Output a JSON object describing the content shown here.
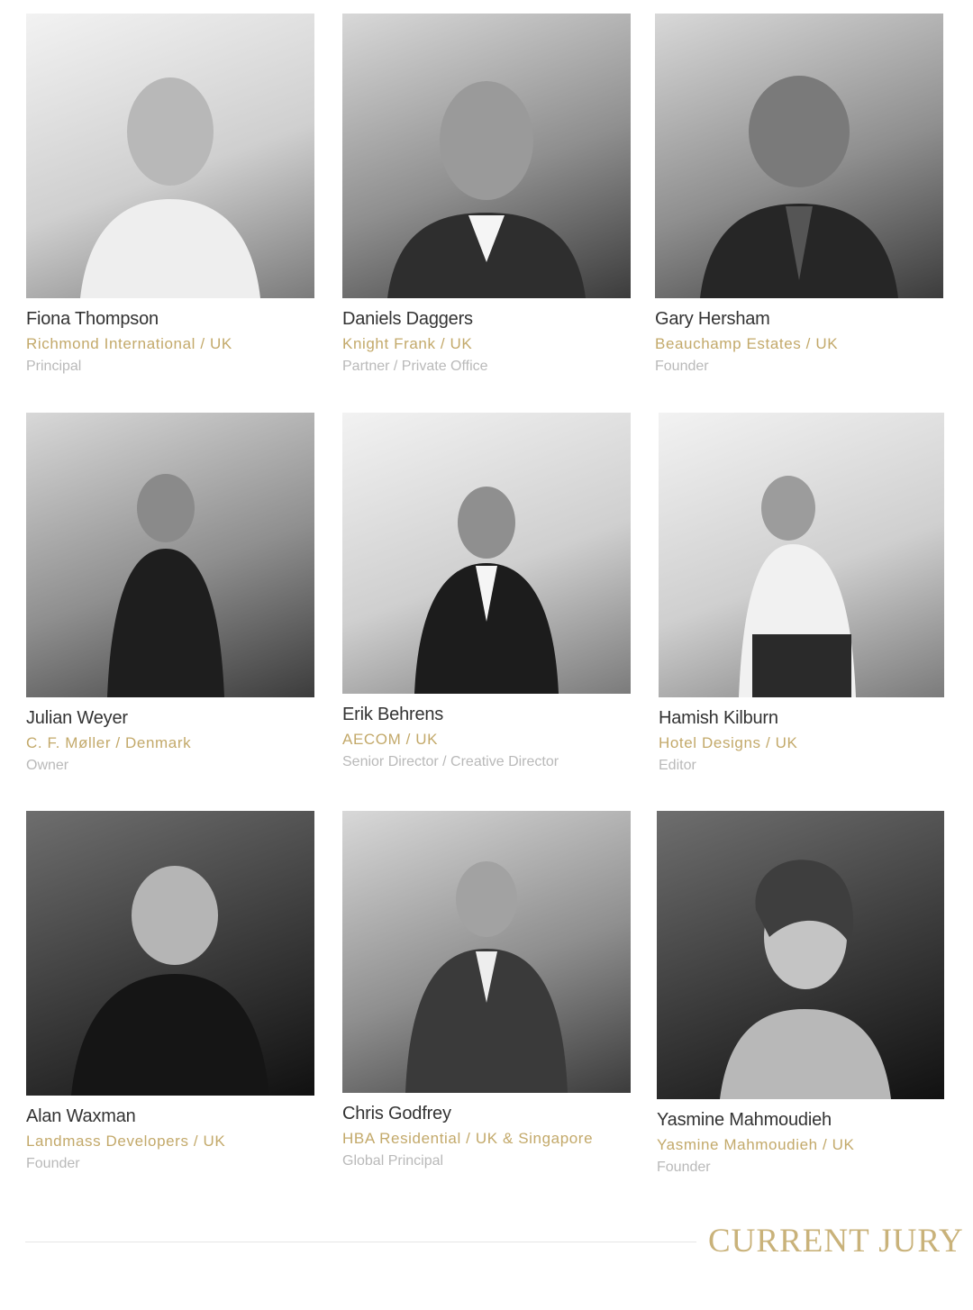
{
  "jury": [
    {
      "name": "Fiona Thompson",
      "company": "Richmond International / UK",
      "role": "Principal",
      "photo_alt": "Photo of Fiona Thompson"
    },
    {
      "name": "Daniels Daggers",
      "company": "Knight Frank / UK",
      "role": "Partner / Private Office",
      "photo_alt": "Photo of Daniels Daggers"
    },
    {
      "name": "Gary Hersham",
      "company": "Beauchamp Estates / UK",
      "role": "Founder",
      "photo_alt": "Photo of Gary Hersham"
    },
    {
      "name": "Julian Weyer",
      "company": "C. F. Møller / Denmark",
      "role": "Owner",
      "photo_alt": "Photo of Julian Weyer"
    },
    {
      "name": "Erik Behrens",
      "company": "AECOM / UK",
      "role": "Senior Director / Creative Director",
      "photo_alt": "Photo of Erik Behrens"
    },
    {
      "name": "Hamish Kilburn",
      "company": "Hotel Designs / UK",
      "role": "Editor",
      "photo_alt": "Photo of Hamish Kilburn"
    },
    {
      "name": "Alan Waxman",
      "company": "Landmass Developers / UK",
      "role": "Founder",
      "photo_alt": "Photo of Alan Waxman"
    },
    {
      "name": "Chris Godfrey",
      "company": "HBA Residential / UK & Singapore",
      "role": "Global Principal",
      "photo_alt": "Photo of Chris Godfrey"
    },
    {
      "name": "Yasmine Mahmoudieh",
      "company": "Yasmine Mahmoudieh / UK",
      "role": "Founder",
      "photo_alt": "Photo of Yasmine Mahmoudieh"
    }
  ],
  "footer": {
    "title": "CURRENT JURY"
  },
  "colors": {
    "accent_gold": "#c3a96a",
    "name_text": "#333333",
    "role_text": "#b9b9b9"
  }
}
